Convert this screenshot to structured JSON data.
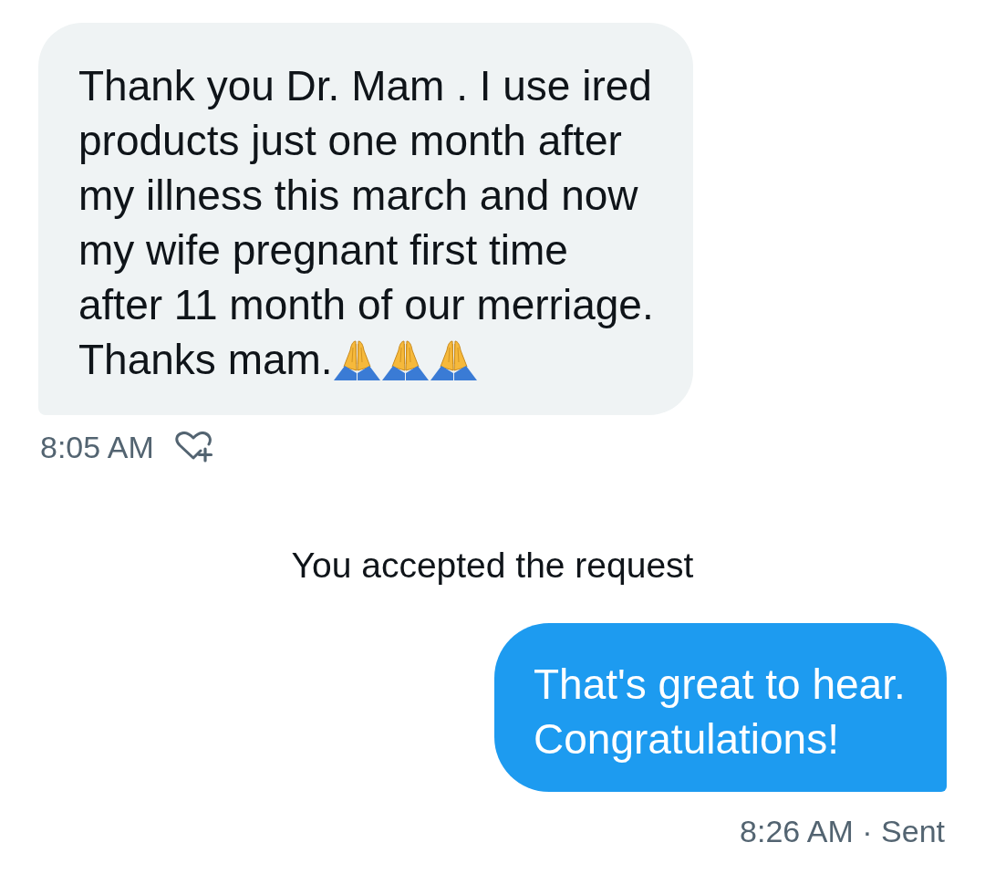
{
  "messages": [
    {
      "kind": "received",
      "text": "Thank you Dr. Mam . I use ired products just one month after my illness this march and now my wife pregnant first time after 11 month of our merriage.",
      "closing": "Thanks mam.",
      "emojis": [
        {
          "kind": "folded-hands"
        },
        {
          "kind": "folded-hands"
        },
        {
          "kind": "folded-hands"
        }
      ],
      "footer": "8:05 AM"
    },
    {
      "kind": "notice",
      "text": "You accepted the request"
    },
    {
      "kind": "sent",
      "text": "That's great to hear. Congratulations!",
      "footer": "8:26 AM · Sent"
    }
  ]
}
